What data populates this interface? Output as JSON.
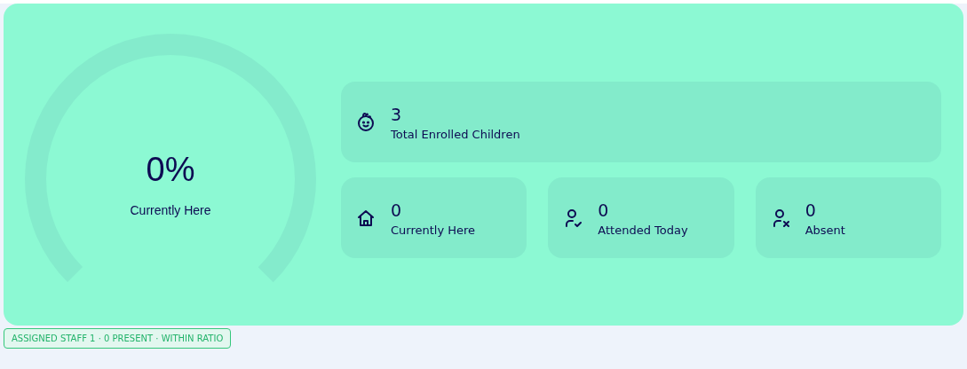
{
  "gauge": {
    "value": "0%",
    "label": "Currently Here"
  },
  "stats": [
    {
      "kind": "child",
      "value": "3",
      "label": "Total Enrolled Children"
    },
    {
      "kind": "home",
      "value": "0",
      "label": "Currently Here"
    },
    {
      "kind": "person-check",
      "value": "0",
      "label": "Attended Today"
    },
    {
      "kind": "person-x",
      "value": "0",
      "label": "Absent"
    }
  ],
  "status_badge": "ASSIGNED STAFF 1 · 0 PRESENT · WITHIN RATIO"
}
